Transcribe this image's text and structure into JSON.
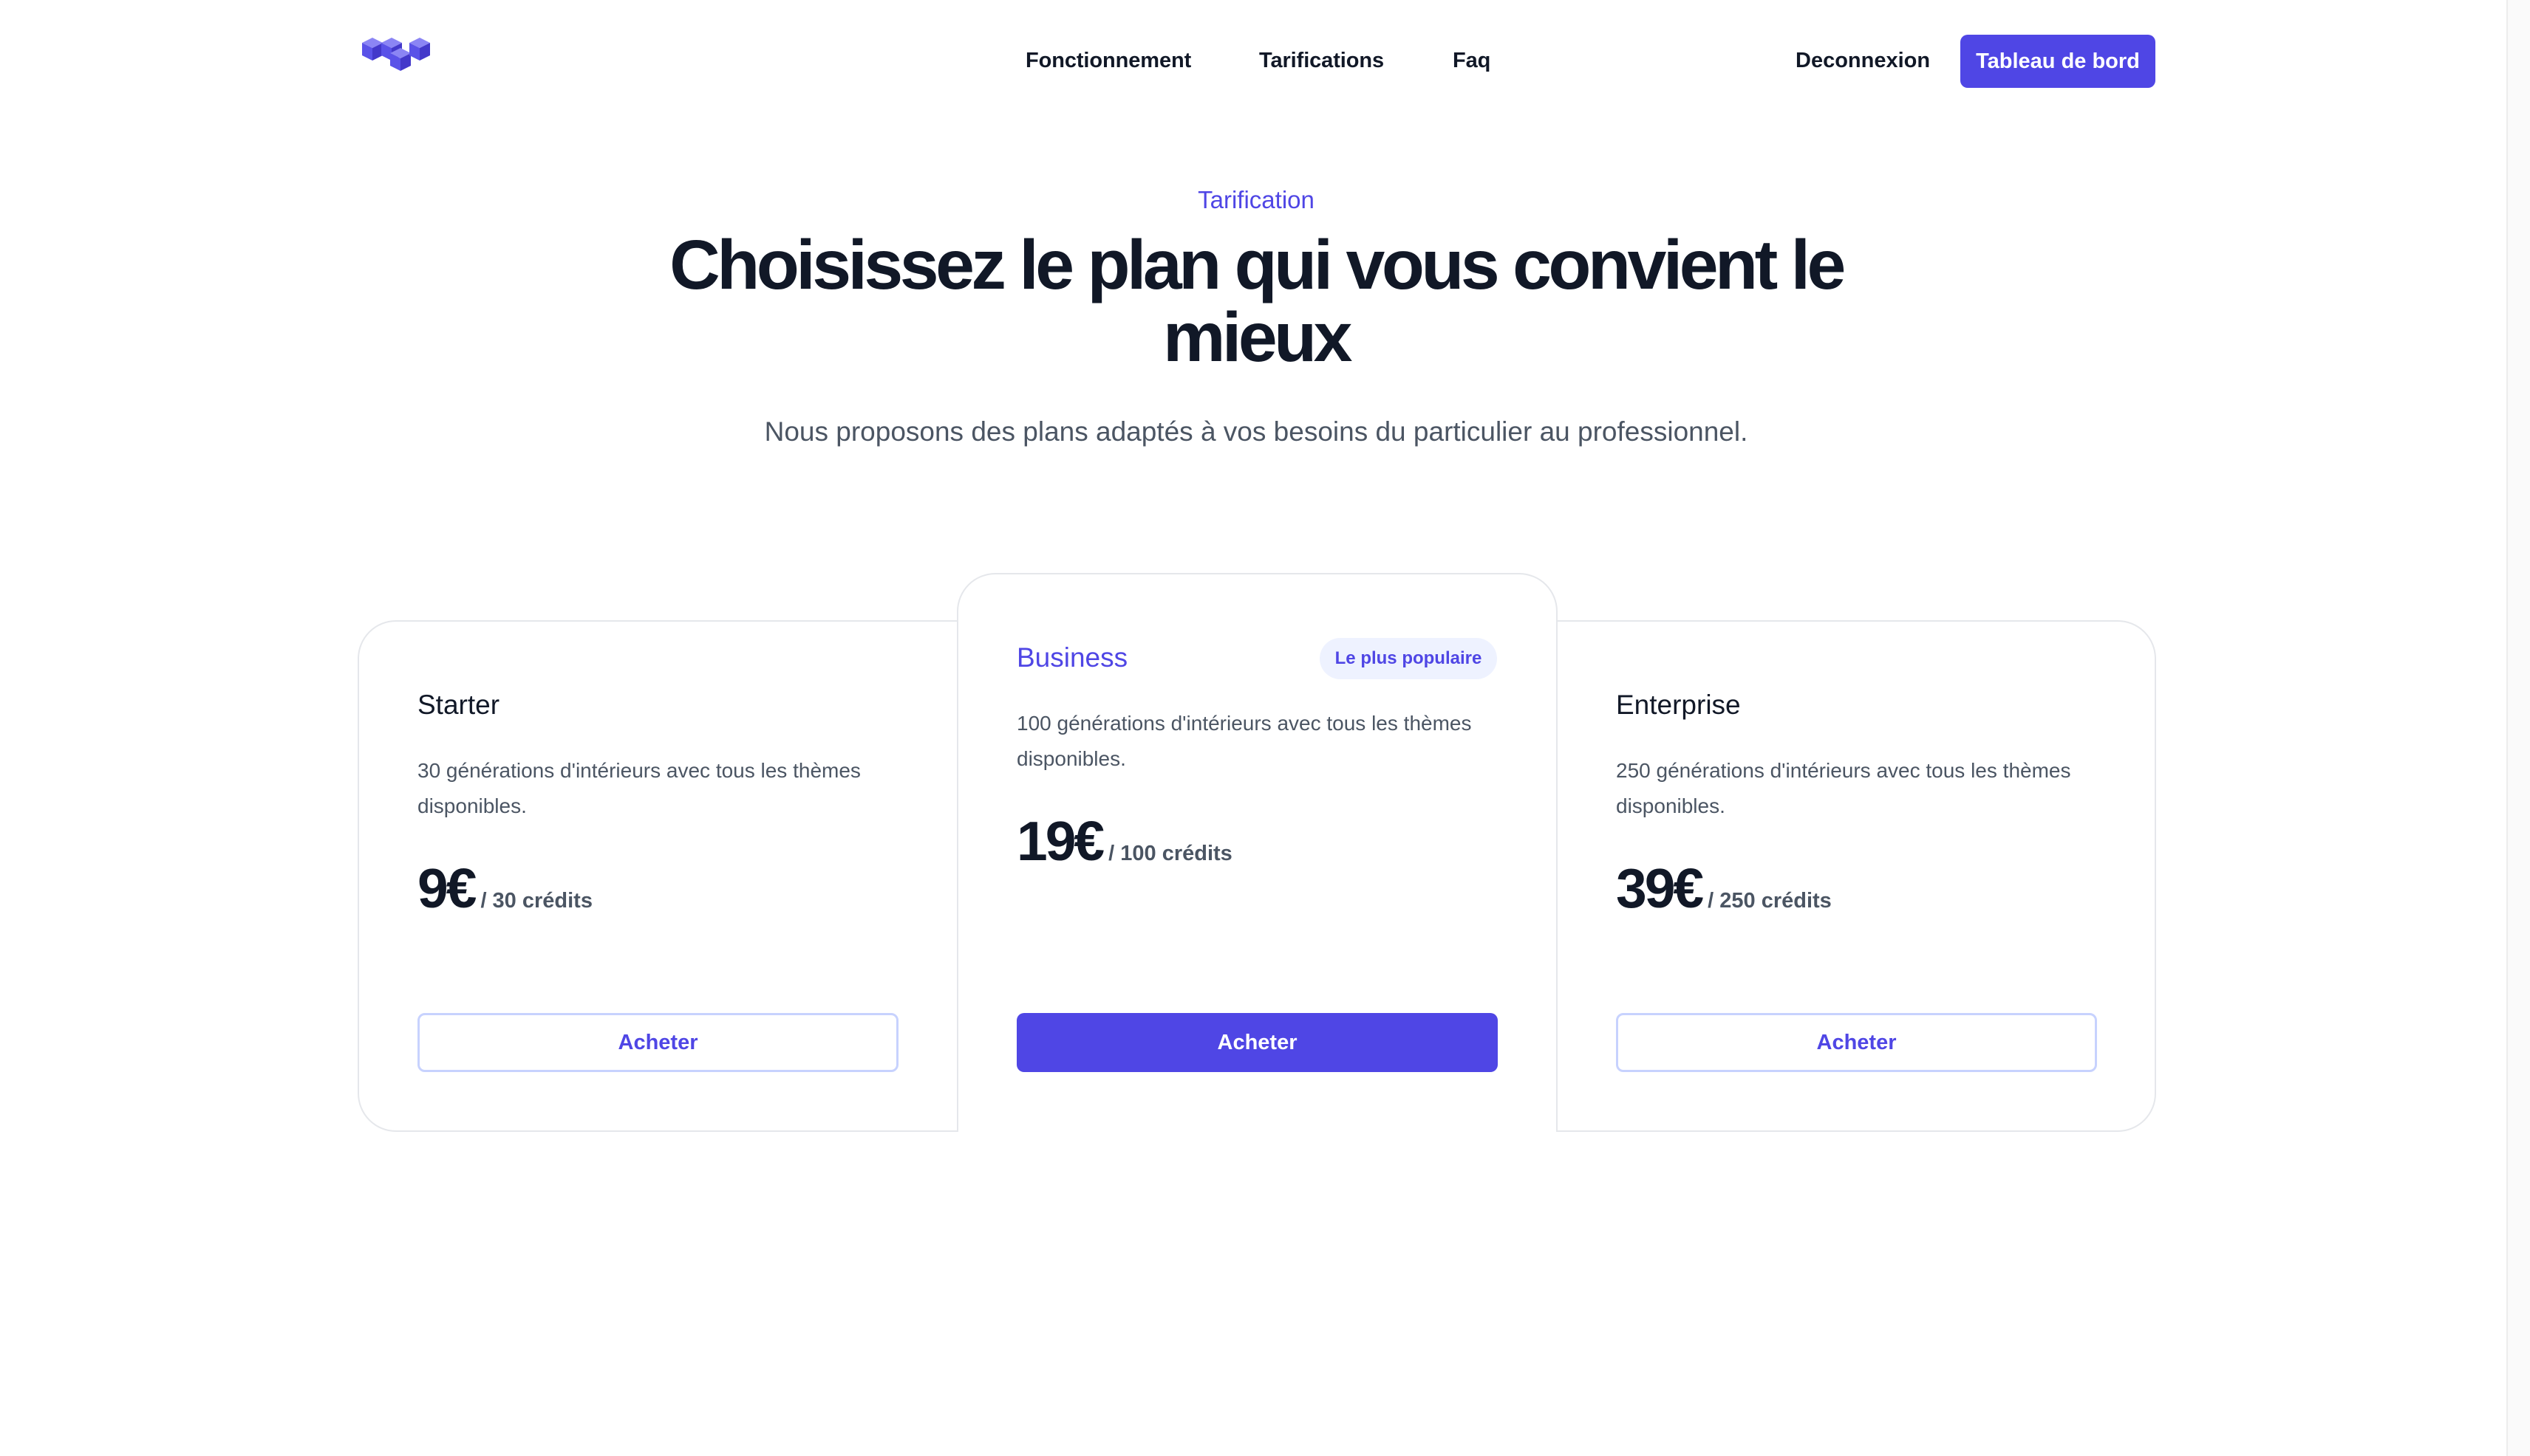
{
  "header": {
    "logo_icon": "cubes-logo-icon",
    "nav": [
      {
        "label": "Fonctionnement"
      },
      {
        "label": "Tarifications"
      },
      {
        "label": "Faq"
      }
    ],
    "logout_label": "Deconnexion",
    "dashboard_label": "Tableau de bord"
  },
  "hero": {
    "eyebrow": "Tarification",
    "title": "Choisissez le plan qui vous convient le mieux",
    "subtitle": "Nous proposons des plans adaptés à vos besoins du particulier au professionnel."
  },
  "plans": [
    {
      "name": "Starter",
      "description": "30 générations d'intérieurs avec tous les thèmes disponibles.",
      "price": "9€",
      "unit": "/ 30 crédits",
      "button": "Acheter"
    },
    {
      "name": "Business",
      "badge": "Le plus populaire",
      "description": "100 générations d'intérieurs avec tous les thèmes disponibles.",
      "price": "19€",
      "unit": "/ 100 crédits",
      "button": "Acheter"
    },
    {
      "name": "Enterprise",
      "description": "250 générations d'intérieurs avec tous les thèmes disponibles.",
      "price": "39€",
      "unit": "/ 250 crédits",
      "button": "Acheter"
    }
  ],
  "colors": {
    "accent": "#4f46e5",
    "text_dark": "#111827",
    "text_muted": "#4b5563",
    "badge_bg": "#eef2ff",
    "border": "#e5e7eb"
  }
}
